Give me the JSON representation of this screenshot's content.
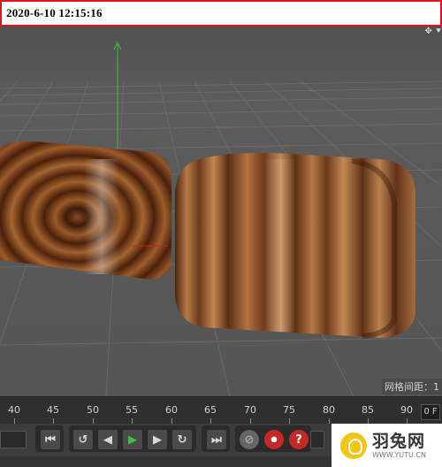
{
  "timestamp": "2020-6-10  12:15:16",
  "viewport": {
    "nav_icons": "✥ ⯆",
    "grid_spacing_label": "网格间距：1"
  },
  "timeline": {
    "ticks": [
      "40",
      "45",
      "50",
      "55",
      "60",
      "65",
      "70",
      "75",
      "80",
      "85",
      "90"
    ],
    "frame_field": "0 F"
  },
  "toolbar": {
    "icons": {
      "go_to_start": "⏮",
      "prev_key": "↺",
      "prev_frame": "◀",
      "play": "▶",
      "next_frame": "▶",
      "next_key": "↻",
      "go_to_end": "⏭",
      "keyframe": "⊘",
      "record": "⏺",
      "help": "?"
    }
  },
  "logo": {
    "name": "羽兔网",
    "url": "WWW.YUTU.CN"
  },
  "colors": {
    "timestamp_border": "#e1141b",
    "viewport_bg": "#5a5a5a",
    "axis_green": "#3bbf3b",
    "axis_red": "#d22020",
    "play_green": "#3dc23d",
    "logo_yellow": "#f3c516"
  }
}
